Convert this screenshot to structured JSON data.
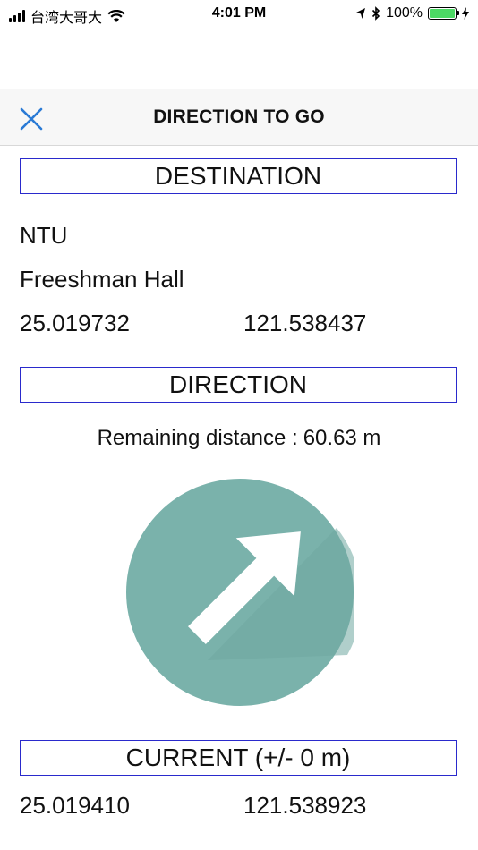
{
  "status_bar": {
    "carrier": "台湾大哥大",
    "time": "4:01 PM",
    "battery": "100%",
    "battery_level": 1.0
  },
  "header": {
    "title": "DIRECTION TO GO",
    "close_icon": "close-icon"
  },
  "destination": {
    "heading": "DESTINATION",
    "name": "NTU",
    "place": "Freeshman Hall",
    "latitude": "25.019732",
    "longitude": "121.538437"
  },
  "direction": {
    "heading": "DIRECTION",
    "remaining_label": "Remaining distance :",
    "remaining_value": "60.63 m",
    "arrow_icon": "direction-arrow-icon",
    "circle_color": "#7ab2ab",
    "arrow_bearing_deg": 45
  },
  "current": {
    "heading": "CURRENT (+/- 0 m)",
    "latitude": "25.019410",
    "longitude": "121.538923"
  },
  "colors": {
    "accent": "#2a7ad5",
    "box_border": "#2a2acc"
  }
}
